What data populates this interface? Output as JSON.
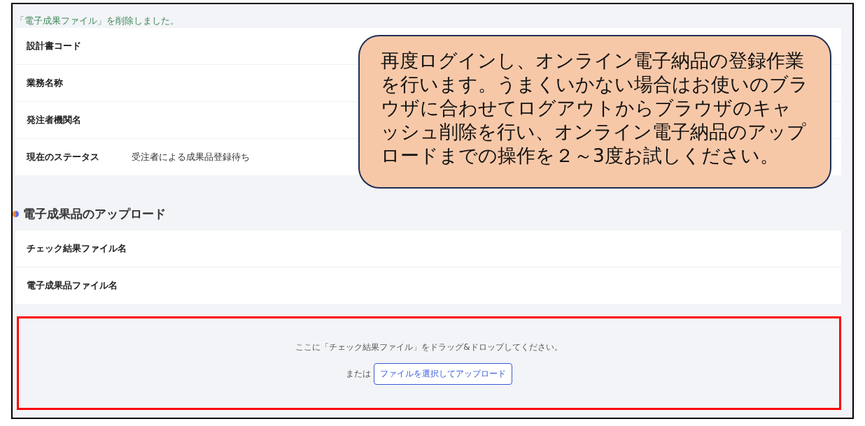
{
  "notice": "「電子成果ファイル」を削除しました。",
  "info_rows": [
    {
      "label": "設計書コード"
    },
    {
      "label": "業務名称"
    },
    {
      "label": "発注者機関名"
    },
    {
      "label": "現在のステータス",
      "value": "受注者による成果品登録待ち"
    }
  ],
  "upload_section": {
    "title": "電子成果品のアップロード",
    "rows": [
      {
        "label": "チェック結果ファイル名"
      },
      {
        "label": "電子成果品ファイル名"
      }
    ],
    "dropzone": {
      "instruction": "ここに「チェック結果ファイル」をドラッグ&ドロップしてください。",
      "or_label": "または",
      "button": "ファイルを選択してアップロード"
    }
  },
  "callout": "再度ログインし、オンライン電子納品の登録作業を行います。うまくいかない場合はお使いのブラウザに合わせてログアウトからブラウザのキャッシュ削除を行い、オンライン電子納品のアップロードまでの操作を２～3度お試しください。"
}
